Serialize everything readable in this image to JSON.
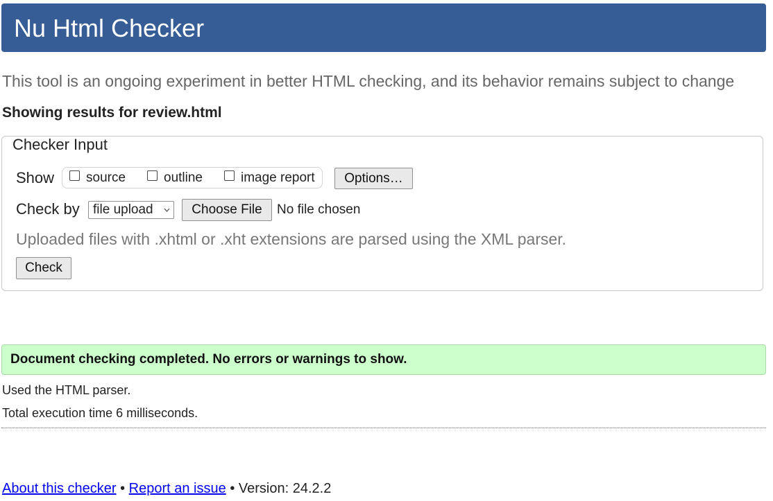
{
  "header": {
    "title": "Nu Html Checker"
  },
  "intro": "This tool is an ongoing experiment in better HTML checking, and its behavior remains subject to change",
  "results_heading": "Showing results for review.html",
  "checker_input": {
    "legend": "Checker Input",
    "show_label": "Show",
    "show_options": [
      {
        "label": "source",
        "checked": false
      },
      {
        "label": "outline",
        "checked": false
      },
      {
        "label": "image report",
        "checked": false
      }
    ],
    "options_button": "Options…",
    "check_by_label": "Check by",
    "check_by_selected": "file upload",
    "choose_file_button": "Choose File",
    "no_file_text": "No file chosen",
    "note": "Uploaded files with .xhtml or .xht extensions are parsed using the XML parser.",
    "check_button": "Check"
  },
  "result": {
    "message": "Document checking completed. No errors or warnings to show.",
    "parser_info": "Used the HTML parser.",
    "time_info": "Total execution time 6 milliseconds."
  },
  "footer": {
    "about_link": "About this checker",
    "separator": "•",
    "report_link": "Report an issue",
    "version": "Version: 24.2.2"
  },
  "colors": {
    "header_bg": "#365d95",
    "success_bg": "#ccffcc",
    "link": "#0000ee"
  },
  "icons": {
    "select_chevron": "chevron-down-icon"
  }
}
